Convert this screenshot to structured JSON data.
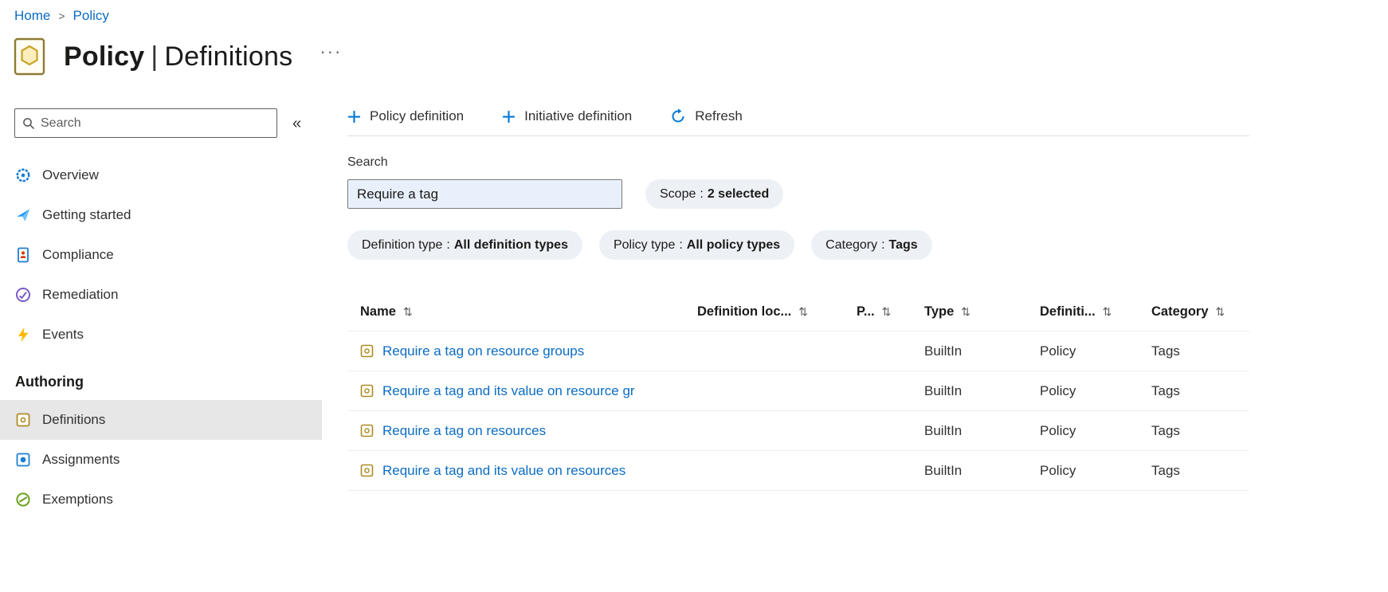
{
  "breadcrumb": {
    "separator": ">",
    "items": [
      {
        "label": "Home"
      },
      {
        "label": "Policy"
      }
    ]
  },
  "header": {
    "title_primary": "Policy",
    "title_separator": "|",
    "title_secondary": "Definitions",
    "more_glyph": "···"
  },
  "sidebar": {
    "search_placeholder": "Search",
    "collapse_glyph": "«",
    "items": [
      {
        "label": "Overview",
        "icon": "overview-icon"
      },
      {
        "label": "Getting started",
        "icon": "getting-started-icon"
      },
      {
        "label": "Compliance",
        "icon": "compliance-icon"
      },
      {
        "label": "Remediation",
        "icon": "remediation-icon"
      },
      {
        "label": "Events",
        "icon": "events-icon"
      }
    ],
    "section_label": "Authoring",
    "authoring_items": [
      {
        "label": "Definitions",
        "icon": "definitions-icon",
        "selected": true
      },
      {
        "label": "Assignments",
        "icon": "assignments-icon",
        "selected": false
      },
      {
        "label": "Exemptions",
        "icon": "exemptions-icon",
        "selected": false
      }
    ]
  },
  "toolbar": {
    "policy_definition_label": "Policy definition",
    "initiative_definition_label": "Initiative definition",
    "refresh_label": "Refresh"
  },
  "filters": {
    "search_label": "Search",
    "search_value": "Require a tag",
    "pill_separator": ":",
    "pills": [
      {
        "label": "Scope",
        "value": "2 selected"
      },
      {
        "label": "Definition type",
        "value": "All definition types"
      },
      {
        "label": "Policy type",
        "value": "All policy types"
      },
      {
        "label": "Category",
        "value": "Tags"
      }
    ]
  },
  "table": {
    "sort_glyph": "⇅",
    "columns": [
      "Name",
      "Definition loc...",
      "P...",
      "Type",
      "Definiti...",
      "Category"
    ],
    "rows": [
      {
        "name": "Require a tag on resource groups",
        "definition_location": "",
        "p": "",
        "type": "BuiltIn",
        "definition_type": "Policy",
        "category": "Tags"
      },
      {
        "name": "Require a tag and its value on resource gr",
        "definition_location": "",
        "p": "",
        "type": "BuiltIn",
        "definition_type": "Policy",
        "category": "Tags"
      },
      {
        "name": "Require a tag on resources",
        "definition_location": "",
        "p": "",
        "type": "BuiltIn",
        "definition_type": "Policy",
        "category": "Tags"
      },
      {
        "name": "Require a tag and its value on resources",
        "definition_location": "",
        "p": "",
        "type": "BuiltIn",
        "definition_type": "Policy",
        "category": "Tags"
      }
    ]
  },
  "colors": {
    "accent": "#0078d4",
    "link": "#0b6cc4",
    "selected_nav_bg": "#e7e7e7"
  }
}
